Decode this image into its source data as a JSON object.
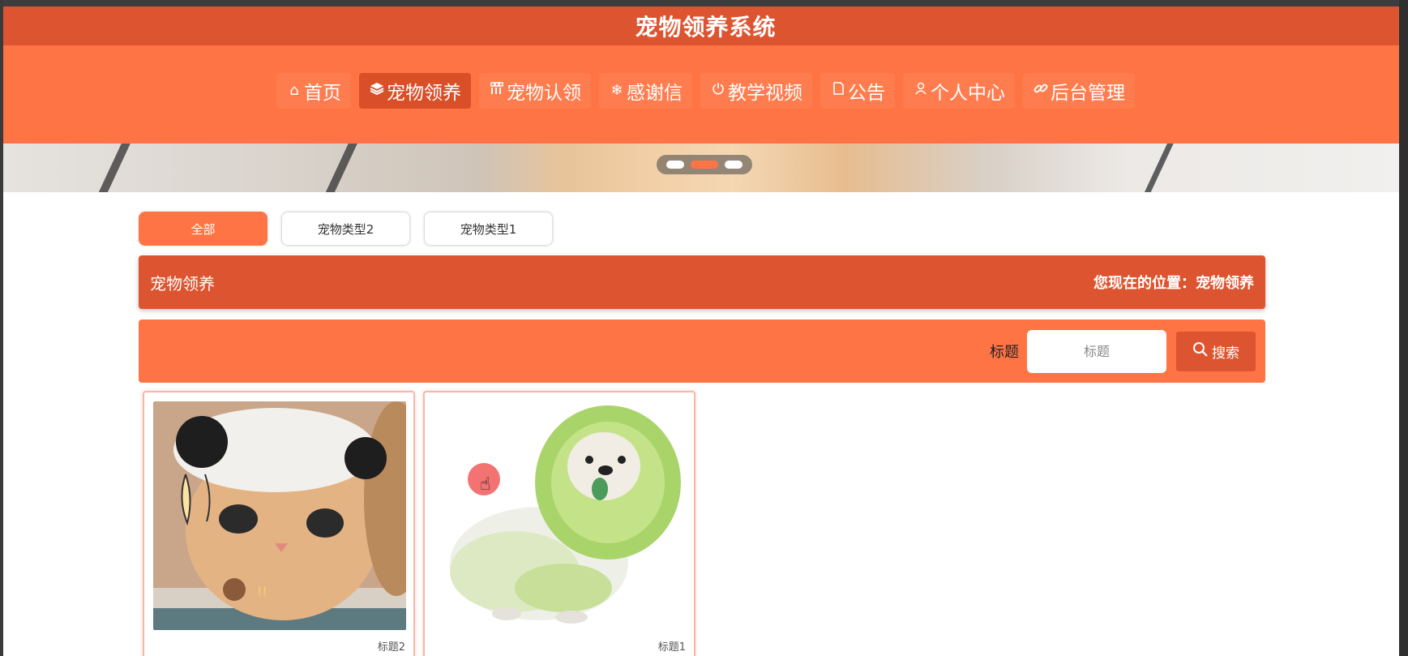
{
  "header": {
    "title": "宠物领养系统"
  },
  "nav": {
    "items": [
      {
        "label": "首页",
        "icon": "home-icon",
        "glyph": "⌂",
        "active": false
      },
      {
        "label": "宠物领养",
        "icon": "layers-icon",
        "glyph": "☰",
        "active": true
      },
      {
        "label": "宠物认领",
        "icon": "grid-icon",
        "glyph": "▦",
        "active": false
      },
      {
        "label": "感谢信",
        "icon": "snowflake-icon",
        "glyph": "❄",
        "active": false
      },
      {
        "label": "教学视频",
        "icon": "power-icon",
        "glyph": "⏻",
        "active": false
      },
      {
        "label": "公告",
        "icon": "note-icon",
        "glyph": "▢",
        "active": false
      },
      {
        "label": "个人中心",
        "icon": "user-icon",
        "glyph": "♙",
        "active": false
      },
      {
        "label": "后台管理",
        "icon": "link-icon",
        "glyph": "∞",
        "active": false
      }
    ]
  },
  "filters": [
    {
      "label": "全部",
      "active": true
    },
    {
      "label": "宠物类型2",
      "active": false
    },
    {
      "label": "宠物类型1",
      "active": false
    }
  ],
  "breadcrumb": {
    "title": "宠物领养",
    "location": "您现在的位置：宠物领养"
  },
  "search": {
    "label": "标题",
    "placeholder": "标题",
    "button_label": "搜索",
    "button_icon": "search-icon"
  },
  "cards": [
    {
      "title": "标题2",
      "image": "cat-with-bear-hat"
    },
    {
      "title": "标题1",
      "image": "cabbage-dog"
    }
  ],
  "colors": {
    "primary": "#ff7444",
    "dark": "#dd5530"
  }
}
